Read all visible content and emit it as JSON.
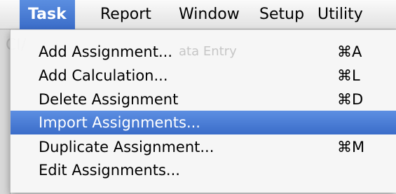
{
  "menubar": {
    "items": [
      {
        "label": "Task"
      },
      {
        "label": "Report"
      },
      {
        "label": "Window"
      },
      {
        "label": "Setup"
      },
      {
        "label": "Utility"
      }
    ],
    "active_item": "Task"
  },
  "background": {
    "title_fragment": "CI/",
    "blurred_fragment": "ata Entry"
  },
  "menu": {
    "items": [
      {
        "label": "Add Assignment...",
        "shortcut": "⌘A"
      },
      {
        "label": "Add Calculation...",
        "shortcut": "⌘L"
      },
      {
        "label": "Delete Assignment",
        "shortcut": "⌘D"
      },
      {
        "label": "Import Assignments...",
        "shortcut": ""
      },
      {
        "label": "Duplicate Assignment...",
        "shortcut": "⌘M"
      },
      {
        "label": "Edit Assignments...",
        "shortcut": ""
      }
    ],
    "selected_item": "Import Assignments..."
  },
  "colors": {
    "highlight": "#3b6dc9"
  }
}
